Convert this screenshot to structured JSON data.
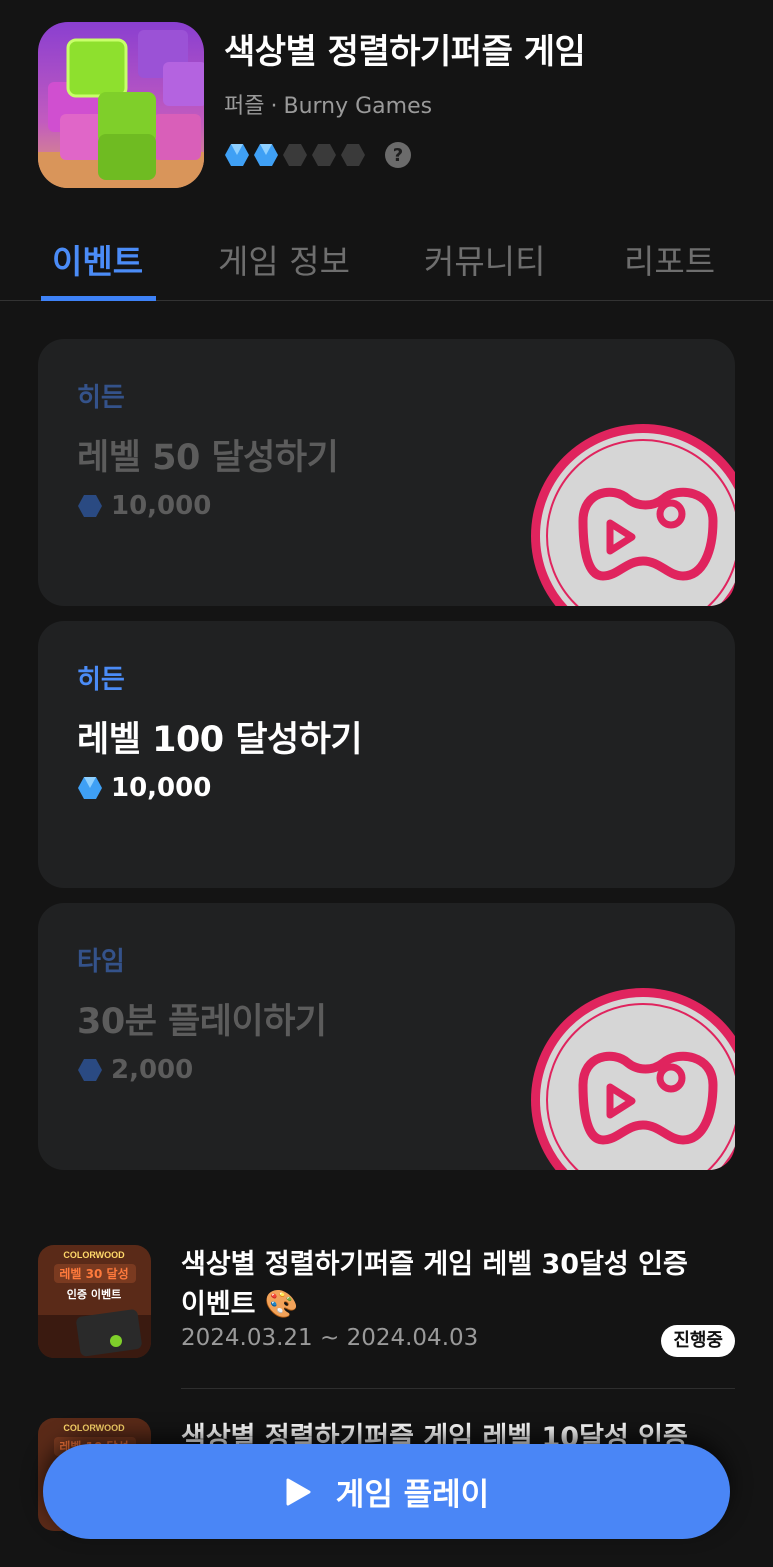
{
  "app": {
    "title": "색상별 정렬하기퍼즐 게임",
    "category": "퍼즐",
    "separator": "·",
    "developer": "Burny Games",
    "difficulty_filled": 2,
    "difficulty_total": 5,
    "help_label": "?"
  },
  "tabs": [
    {
      "label": "이벤트",
      "active": true
    },
    {
      "label": "게임 정보",
      "active": false
    },
    {
      "label": "커뮤니티",
      "active": false
    },
    {
      "label": "리포트",
      "active": false
    }
  ],
  "missions": [
    {
      "tag": "히든",
      "title": "레벨 50 달성하기",
      "reward": "10,000",
      "completed": true
    },
    {
      "tag": "히든",
      "title": "레벨 100 달성하기",
      "reward": "10,000",
      "completed": false
    },
    {
      "tag": "타임",
      "title": "30분 플레이하기",
      "reward": "2,000",
      "completed": true
    }
  ],
  "events": [
    {
      "title": "색상별 정렬하기퍼즐 게임 레벨 30달성 인증 이벤트 🎨",
      "date": "2024.03.21 ~ 2024.04.03",
      "status": "진행중",
      "thumb_brand": "COLORWOOD",
      "thumb_headline": "레벨 30 달성",
      "thumb_sub": "인증 이벤트"
    },
    {
      "title": "색상별 정렬하기퍼즐 게임 레벨 10달성 인증",
      "thumb_brand": "COLORWOOD",
      "thumb_headline": "레벨 10 달성"
    }
  ],
  "play_button": {
    "label": "게임 플레이"
  },
  "colors": {
    "accent": "#4A86F6",
    "badge_pink": "#E0245E",
    "background": "#141414"
  }
}
